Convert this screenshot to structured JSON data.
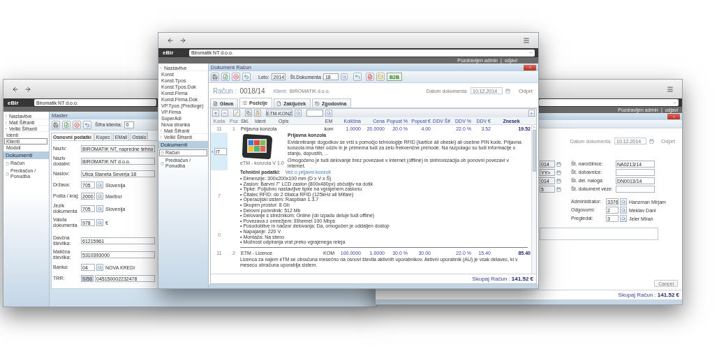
{
  "left_window": {
    "brand": "eBir",
    "company": "Biromatik NT d.o.o.",
    "sidebar": [
      {
        "label": "Nastavitve",
        "expanded": false
      },
      {
        "label": "Mali Šifranti",
        "expanded": false
      },
      {
        "label": "Veliki Šifranti",
        "expanded": true,
        "children": [
          {
            "label": "Identi",
            "selected": false
          },
          {
            "label": "Klienti",
            "selected": true
          },
          {
            "label": "Moduli",
            "selected": false
          }
        ]
      }
    ],
    "documents_header": "Dokumenti",
    "documents": [
      {
        "label": "Račun",
        "selected": false
      },
      {
        "label": "Predračun / Ponudba",
        "selected": false
      }
    ],
    "panel_title": "Master",
    "code_label": "Šifra klienta:",
    "code_value": "0",
    "tabs": [
      {
        "label": "Osnovni podatki",
        "selected": true
      },
      {
        "label": "Kupec",
        "selected": false
      },
      {
        "label": "EMail",
        "selected": false
      },
      {
        "label": "Ostalo",
        "selected": false
      }
    ],
    "field_groups": [
      [
        {
          "kind": "text",
          "label": "Naziv:",
          "value": "BIROMATIK NT, napredne tehno"
        },
        {
          "kind": "text",
          "label": "Naziv dodatni:",
          "value": "BIROMATIK NT d.o.o."
        },
        {
          "kind": "text",
          "label": "Naslov:",
          "value": "Ulica Staneta Severja 18"
        },
        {
          "kind": "lookup",
          "label": "Država:",
          "value": "705",
          "lookup": "Slovenija"
        },
        {
          "kind": "lookup",
          "label": "Pošta / kraj:",
          "value": "2000",
          "lookup": "Maribor"
        },
        {
          "kind": "lookup",
          "label": "Jezik dokumenta",
          "value": "705",
          "lookup": "Slovenija"
        },
        {
          "kind": "lookup",
          "label": "Valuta dokumenta",
          "value": "978",
          "lookup": "€"
        }
      ],
      [
        {
          "kind": "text",
          "label": "Davčna številka:",
          "value": "61215961"
        },
        {
          "kind": "text",
          "label": "Matična številka:",
          "value": "5310393000"
        },
        {
          "kind": "lookup",
          "label": "Banka:",
          "value": "04",
          "lookup": "NOVA KREDI"
        },
        {
          "kind": "iban",
          "label": "TRR:",
          "prefix": "SI56",
          "value": "045150002232478"
        }
      ]
    ]
  },
  "right_window": {
    "greeting": "Pozdravljen admin",
    "separator": "|",
    "logout": "odjavi",
    "date_label": "Datum dokumenta:",
    "date": "10.12.2014",
    "status": "Odprt",
    "date_fields": [
      "014",
      "YY>",
      "014",
      "5"
    ],
    "fields": [
      {
        "label": "Št. naročilnice:",
        "value": "NA0213/14"
      },
      {
        "label": "Št. dobavnice:"
      },
      {
        "label": "Št. del. naloga:",
        "value": "DN0013/14"
      },
      {
        "label": "Št. dokument veze:"
      }
    ],
    "people": [
      {
        "label": "Administrator:",
        "code": "3376",
        "name": "Hanzman Mirjam"
      },
      {
        "label": "Odgovorni:",
        "code": "2",
        "name": "Meklav Dani"
      },
      {
        "label": "Pregledal:",
        "code": "3",
        "name": "Jeler Miran"
      }
    ],
    "cancel": "Cancel",
    "total_label": "Skupaj Račun :",
    "total": "141.52 €"
  },
  "main_window": {
    "brand": "eBir",
    "company": "Biromatik NT d.o.o.",
    "greeting": "Pozdravljen admin",
    "separator": "|",
    "logout": "odjavi",
    "sidebar": [
      {
        "label": "Nastavitve",
        "expanded": true,
        "children": [
          {
            "label": "Konst",
            "selected": false
          },
          {
            "label": "Konst.Tpos",
            "selected": false
          },
          {
            "label": "Konst.Tpos.Dok",
            "selected": false
          },
          {
            "label": "Konst.Firma",
            "selected": false
          },
          {
            "label": "Konst.Firma.Dok",
            "selected": false
          },
          {
            "label": "VP.Tpos (Predloge)",
            "selected": false
          },
          {
            "label": "VP.Firma",
            "selected": false
          },
          {
            "label": "SuperAdi",
            "selected": false
          },
          {
            "label": "Nova stranka",
            "selected": false
          }
        ]
      },
      {
        "label": "Mali Šifranti",
        "expanded": false
      },
      {
        "label": "Veliki Šifranti",
        "expanded": false
      }
    ],
    "documents_header": "Dokumenti",
    "documents": [
      {
        "label": "Račun",
        "selected": true
      },
      {
        "label": "Predračun / Ponudba",
        "selected": false
      }
    ],
    "panel_title": "Dokument Račun",
    "year_label": "Leto:",
    "year": "2014",
    "docnum_label": "Št.Dokumenta",
    "docnum": "18",
    "b2b": "B2B",
    "doc_label": "Račun :",
    "doc_number": "0018/14",
    "client_label": "Klient:",
    "client": "BIROMATIK d.o.o.",
    "date_label": "Datum dokumenta:",
    "date": "10.12.2014",
    "status": "Odprt",
    "tabs": [
      {
        "label": "Glava",
        "selected": false
      },
      {
        "label": "Pozicije",
        "selected": true
      },
      {
        "label": "Zaključek",
        "selected": false
      },
      {
        "label": "Zgodovina",
        "selected": false
      }
    ],
    "filter_value": "ETM-KONZ",
    "columns": [
      "Koda",
      "Poz",
      "Skl.",
      "Ident",
      "Opis",
      "EM",
      "Količina",
      "Cena",
      "Popust %",
      "Popust €",
      "DDV Šif",
      "DDV %",
      "DDV €",
      "Znesek"
    ],
    "rows": [
      {
        "koda": "11",
        "poz": "1",
        "name": "Prijavna konzola",
        "em": "kom",
        "quantity": "1.0000",
        "price": "20.0000",
        "discount_pct": "20.0 %",
        "discount": "4.00",
        "vat_pct": "22.0 %",
        "vat": "3.52",
        "amount": "19.52"
      },
      {
        "koda": "11",
        "poz": "2",
        "name": "ETM - Licence",
        "em": "KOM",
        "quantity": "100.0000",
        "price": "1.0000",
        "discount_pct": "30.0 %",
        "discount": "30.00",
        "vat_pct": "22.0 %",
        "vat": "15.40",
        "amount": "85.40"
      }
    ],
    "detail": {
      "edit_value": "IT",
      "side_values": [
        "7",
        "0"
      ],
      "image_caption": "eTM - konzola V 1.0",
      "title": "Prijavna konzola",
      "paragraphs": [
        "Evidentiranje dogodkov se vrši s pomočjo tehnologije RFID (kartice ali obeski) ali osebne PIN kode. Prijavna konzola ima hiter odziv in je primerna tudi za zelo frekvenčne prehode. Na razpolago so tudi informacije o stanju, dopustih, ...",
        "Omogočeno je tudi delovanje brez povezave v internet (offline) in sinhronizacija ob ponovni povezavi v internet."
      ],
      "specs_label": "Tehnični podatki:",
      "specs_link": "Več o prijavni konzoli",
      "specs": [
        "• Dimenzije: 300x200x100 mm (D x V x Š)",
        "• Zaslon: Barvni 7\" LCD zaslon (800x480px) občutljiv na dotik",
        "• Tipke: Poljubno nastavljive tipke na vgrajenem zaslonu",
        "• Čitalec RFID: do 2 čitalca RFID (125kHz ali Mifare)",
        "• Operacijski sistem: Raspbian 1.3.7",
        "• Skupen prostor: 8 Gb",
        "• Delovni pomnilnik: 512 Mb",
        "• Delovanje s strežnikom: Online (ob izpadu deluje tudi offline)",
        "• Povezava z omrežjem: Ethernet 100 Mbps",
        "• Posodobitve in nadzor delovanja: Da, omogočen je oddaljen dostop",
        "• Napajanje: 220 V",
        "• Montaža: Na steno",
        "• Možnost odpiranja vrat preko vgrajenega releja"
      ]
    },
    "row2_description": "Licenca za najem eTM se obračuna mesečno na osnovi števila aktivnih uporabnikov. Aktivni uporabnik (AU) je vsak delavec, ki v mesecu obračuna uporablja sistem.",
    "total_label": "Skupaj Račun :",
    "total": "141.52 €"
  }
}
